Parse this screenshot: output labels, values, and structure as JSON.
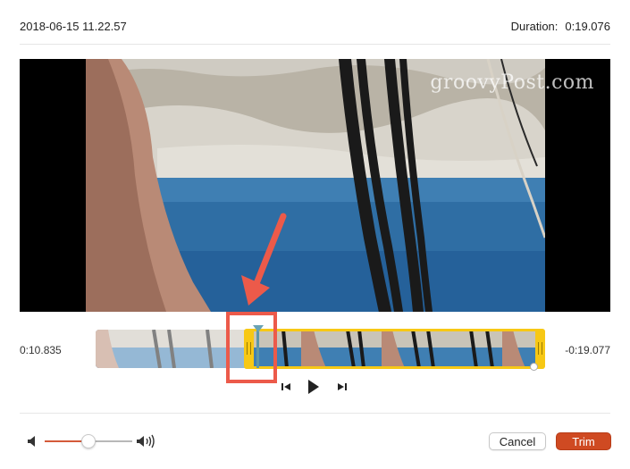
{
  "window": {
    "title": "2018-06-15 11.22.57",
    "duration_label": "Duration:",
    "duration_value": "0:19.076"
  },
  "video": {
    "watermark": "groovyPost.com"
  },
  "timeline": {
    "current_time": "0:10.835",
    "remaining_time": "-0:19.077",
    "trim_start_fraction": 0.34,
    "playhead_fraction": 0.36,
    "trim_end_fraction": 1.0
  },
  "transport": {
    "step_back_icon": "step-back-icon",
    "play_icon": "play-icon",
    "step_forward_icon": "step-forward-icon"
  },
  "volume": {
    "level_fraction": 0.5,
    "low_icon": "speaker-low-icon",
    "high_icon": "speaker-high-icon"
  },
  "buttons": {
    "cancel": "Cancel",
    "trim": "Trim"
  },
  "colors": {
    "trim_button": "#cf4a22",
    "selection_border": "#f7c815",
    "annotation": "#ec5a4a",
    "volume_fill": "#d45a3a"
  }
}
